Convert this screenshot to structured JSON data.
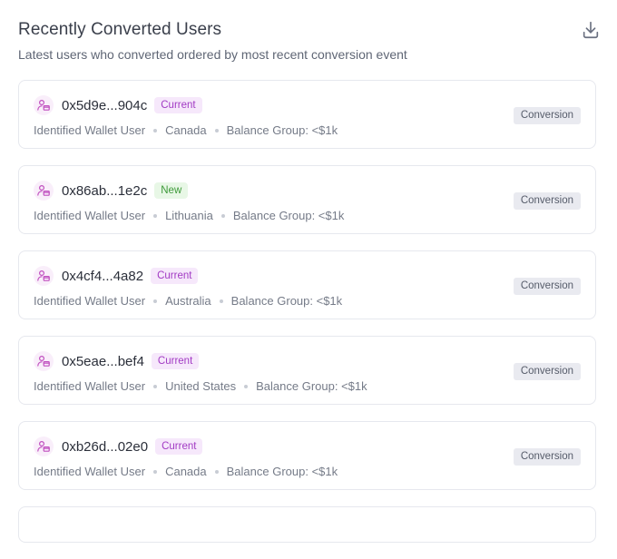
{
  "header": {
    "title": "Recently Converted Users",
    "subtitle": "Latest users who converted ordered by most recent conversion event"
  },
  "icons": {
    "download": "download-icon",
    "avatar": "user-wallet-icon"
  },
  "colors": {
    "current_badge_bg": "#f6e8fb",
    "current_badge_text": "#a23bc4",
    "new_badge_bg": "#e8f7e6",
    "new_badge_text": "#3e9a3a",
    "avatar_icon": "#c04fbf"
  },
  "users": [
    {
      "wallet": "0x5d9e...904c",
      "status": "Current",
      "type": "Identified Wallet User",
      "country": "Canada",
      "balance": "Balance Group: <$1k",
      "tag": "Conversion"
    },
    {
      "wallet": "0x86ab...1e2c",
      "status": "New",
      "type": "Identified Wallet User",
      "country": "Lithuania",
      "balance": "Balance Group: <$1k",
      "tag": "Conversion"
    },
    {
      "wallet": "0x4cf4...4a82",
      "status": "Current",
      "type": "Identified Wallet User",
      "country": "Australia",
      "balance": "Balance Group: <$1k",
      "tag": "Conversion"
    },
    {
      "wallet": "0x5eae...bef4",
      "status": "Current",
      "type": "Identified Wallet User",
      "country": "United States",
      "balance": "Balance Group: <$1k",
      "tag": "Conversion"
    },
    {
      "wallet": "0xb26d...02e0",
      "status": "Current",
      "type": "Identified Wallet User",
      "country": "Canada",
      "balance": "Balance Group: <$1k",
      "tag": "Conversion"
    }
  ]
}
